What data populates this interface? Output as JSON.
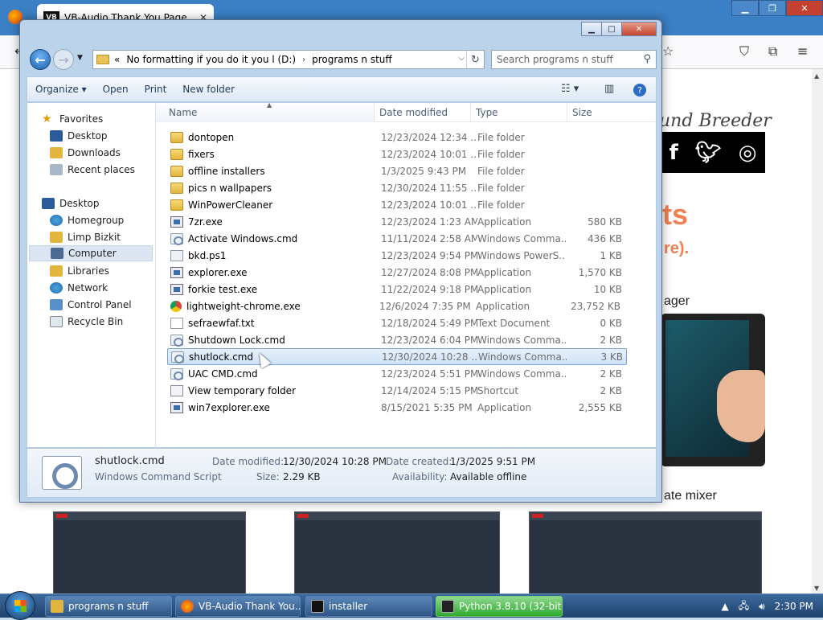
{
  "browser": {
    "tab_title": "VB-Audio Thank You Page",
    "page": {
      "breeder_text": "und Breeder",
      "social_icons": [
        "facebook-icon",
        "twitter-icon",
        "instagram-icon"
      ],
      "heading_fragment": "ts",
      "sub_fragment": "re).",
      "manager_fragment": "ager",
      "mixer_fragment": "ate mixer"
    }
  },
  "explorer": {
    "address": {
      "chevron": "«",
      "segments": [
        "No formatting if you do it you l (D:)",
        "programs n stuff"
      ],
      "separator": "›"
    },
    "search_placeholder": "Search programs n stuff",
    "toolbar": {
      "organize": "Organize",
      "open": "Open",
      "print": "Print",
      "new_folder": "New folder"
    },
    "nav": {
      "favorites": "Favorites",
      "desktop": "Desktop",
      "downloads": "Downloads",
      "recent": "Recent places",
      "desktop2": "Desktop",
      "homegroup": "Homegroup",
      "user": "Limp Bizkit",
      "computer": "Computer",
      "libraries": "Libraries",
      "network": "Network",
      "control_panel": "Control Panel",
      "recycle": "Recycle Bin"
    },
    "columns": {
      "name": "Name",
      "date": "Date modified",
      "type": "Type",
      "size": "Size"
    },
    "files": [
      {
        "name": "dontopen",
        "date": "12/23/2024 12:34 ...",
        "type": "File folder",
        "size": "",
        "icon": "folder"
      },
      {
        "name": "fixers",
        "date": "12/23/2024 10:01 ...",
        "type": "File folder",
        "size": "",
        "icon": "folder"
      },
      {
        "name": "offline installers",
        "date": "1/3/2025 9:43 PM",
        "type": "File folder",
        "size": "",
        "icon": "folder"
      },
      {
        "name": "pics n wallpapers",
        "date": "12/30/2024 11:55 ...",
        "type": "File folder",
        "size": "",
        "icon": "folder"
      },
      {
        "name": "WinPowerCleaner",
        "date": "12/23/2024 10:01 ...",
        "type": "File folder",
        "size": "",
        "icon": "folder"
      },
      {
        "name": "7zr.exe",
        "date": "12/23/2024 1:23 AM",
        "type": "Application",
        "size": "580 KB",
        "icon": "exe"
      },
      {
        "name": "Activate Windows.cmd",
        "date": "11/11/2024 2:58 AM",
        "type": "Windows Comma...",
        "size": "436 KB",
        "icon": "cmd"
      },
      {
        "name": "bkd.ps1",
        "date": "12/23/2024 9:54 PM",
        "type": "Windows PowerS...",
        "size": "1 KB",
        "icon": "ps"
      },
      {
        "name": "explorer.exe",
        "date": "12/27/2024 8:08 PM",
        "type": "Application",
        "size": "1,570 KB",
        "icon": "exe"
      },
      {
        "name": "forkie test.exe",
        "date": "11/22/2024 9:18 PM",
        "type": "Application",
        "size": "10 KB",
        "icon": "exe"
      },
      {
        "name": "lightweight-chrome.exe",
        "date": "12/6/2024 7:35 PM",
        "type": "Application",
        "size": "23,752 KB",
        "icon": "chrome"
      },
      {
        "name": "sefraewfaf.txt",
        "date": "12/18/2024 5:49 PM",
        "type": "Text Document",
        "size": "0 KB",
        "icon": "txt"
      },
      {
        "name": "Shutdown Lock.cmd",
        "date": "12/23/2024 6:04 PM",
        "type": "Windows Comma...",
        "size": "2 KB",
        "icon": "cmd"
      },
      {
        "name": "shutlock.cmd",
        "date": "12/30/2024 10:28 ...",
        "type": "Windows Comma...",
        "size": "3 KB",
        "icon": "cmd",
        "selected": true
      },
      {
        "name": "UAC CMD.cmd",
        "date": "12/23/2024 5:51 PM",
        "type": "Windows Comma...",
        "size": "2 KB",
        "icon": "cmd"
      },
      {
        "name": "View temporary folder",
        "date": "12/14/2024 5:15 PM",
        "type": "Shortcut",
        "size": "2 KB",
        "icon": "lnk"
      },
      {
        "name": "win7explorer.exe",
        "date": "8/15/2021 5:35 PM",
        "type": "Application",
        "size": "2,555 KB",
        "icon": "exe"
      }
    ],
    "details": {
      "name": "shutlock.cmd",
      "kind": "Windows Command Script",
      "date_modified_label": "Date modified:",
      "date_modified": "12/30/2024 10:28 PM",
      "size_label": "Size:",
      "size": "2.29 KB",
      "date_created_label": "Date created:",
      "date_created": "1/3/2025 9:51 PM",
      "availability_label": "Availability:",
      "availability": "Available offline"
    }
  },
  "taskbar": {
    "items": [
      "programs n stuff",
      "VB-Audio Thank You...",
      "installer",
      "Python 3.8.10 (32-bit..."
    ],
    "clock": "2:30 PM"
  },
  "colors": {
    "selection": "#cfe2f7",
    "taskbar": "#2d5687",
    "accent": "#1f5fa8"
  }
}
